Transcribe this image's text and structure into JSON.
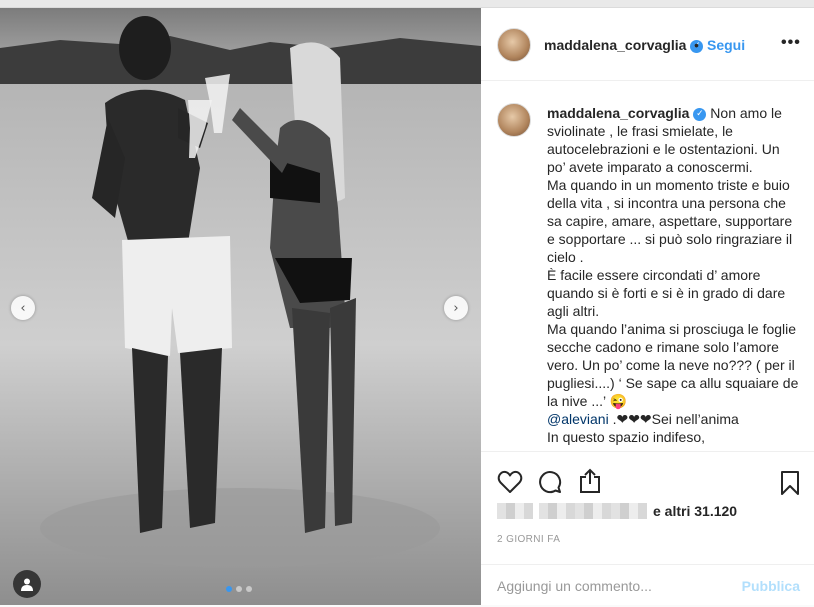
{
  "post": {
    "username": "maddalena_corvaglia",
    "follow_label": "Segui",
    "separator": "•",
    "more_label": "•••",
    "caption_user": "maddalena_corvaglia",
    "caption_text_1": " Non amo le sviolinate , le frasi smielate, le autocelebrazioni e le ostentazioni. Un po’ avete imparato a conoscermi.\nMa quando in un momento triste e buio della vita , si incontra una persona che sa capire, amare, aspettare, supportare e sopportare ... si può solo ringraziare il cielo .\nÈ facile essere circondati d’ amore quando si è forti e si è in grado di dare agli altri.\nMa quando l’anima si prosciuga le foglie secche cadono e rimane solo l’amore vero. Un po’ come la neve no??? ( per il pugliesi....) ‘ Se sape ca allu squaiare de la nive ...’ 😜\n",
    "caption_mention": "@aleviani",
    "caption_text_2": " .❤❤❤Sei nell’anima\nIn questo spazio indifeso,",
    "likes_suffix": "e altri 31.120",
    "timestamp": "2 GIORNI FA",
    "comment_placeholder": "Aggiungi un commento...",
    "publish_label": "Pubblica",
    "prev_label": "‹",
    "next_label": "›"
  },
  "icons": [
    "verified-badge-icon",
    "heart-icon",
    "comment-icon",
    "share-icon",
    "bookmark-icon",
    "user-tag-icon",
    "chevron-left-icon",
    "chevron-right-icon"
  ],
  "colors": {
    "accent": "#3897f0",
    "text": "#262626",
    "muted": "#999999",
    "publish_disabled": "#b2dffc",
    "heart_emoji": "#ed4956"
  }
}
